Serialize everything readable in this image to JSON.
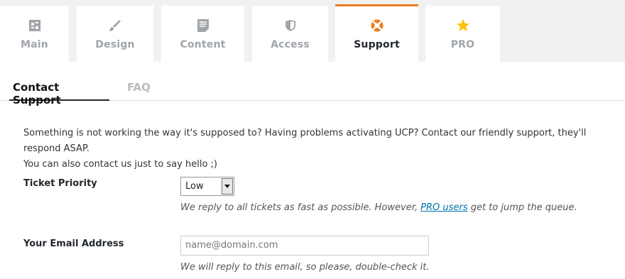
{
  "tabs": [
    {
      "label": "Main",
      "icon": "dashboard-icon"
    },
    {
      "label": "Design",
      "icon": "brush-icon"
    },
    {
      "label": "Content",
      "icon": "document-icon"
    },
    {
      "label": "Access",
      "icon": "shield-icon"
    },
    {
      "label": "Support",
      "icon": "lifebuoy-icon",
      "active": true
    },
    {
      "label": "PRO",
      "icon": "star-icon"
    }
  ],
  "subtabs": {
    "contact": "Contact Support",
    "faq": "FAQ"
  },
  "intro": {
    "line1": "Something is not working the way it's supposed to? Having problems activating UCP? Contact our friendly support, they'll respond ASAP.",
    "line2": "You can also contact us just to say hello ;)"
  },
  "priority": {
    "label": "Ticket Priority",
    "selected": "Low",
    "help_before": "We reply to all tickets as fast as possible. However,",
    "help_link": "PRO users",
    "help_after": "get to jump the queue."
  },
  "email": {
    "label": "Your Email Address",
    "placeholder": "name@domain.com",
    "help": "We will reply to this email, so please, double-check it."
  },
  "colors": {
    "accent": "#ee7d1f",
    "link": "#0073aa",
    "star": "#ffc107"
  }
}
